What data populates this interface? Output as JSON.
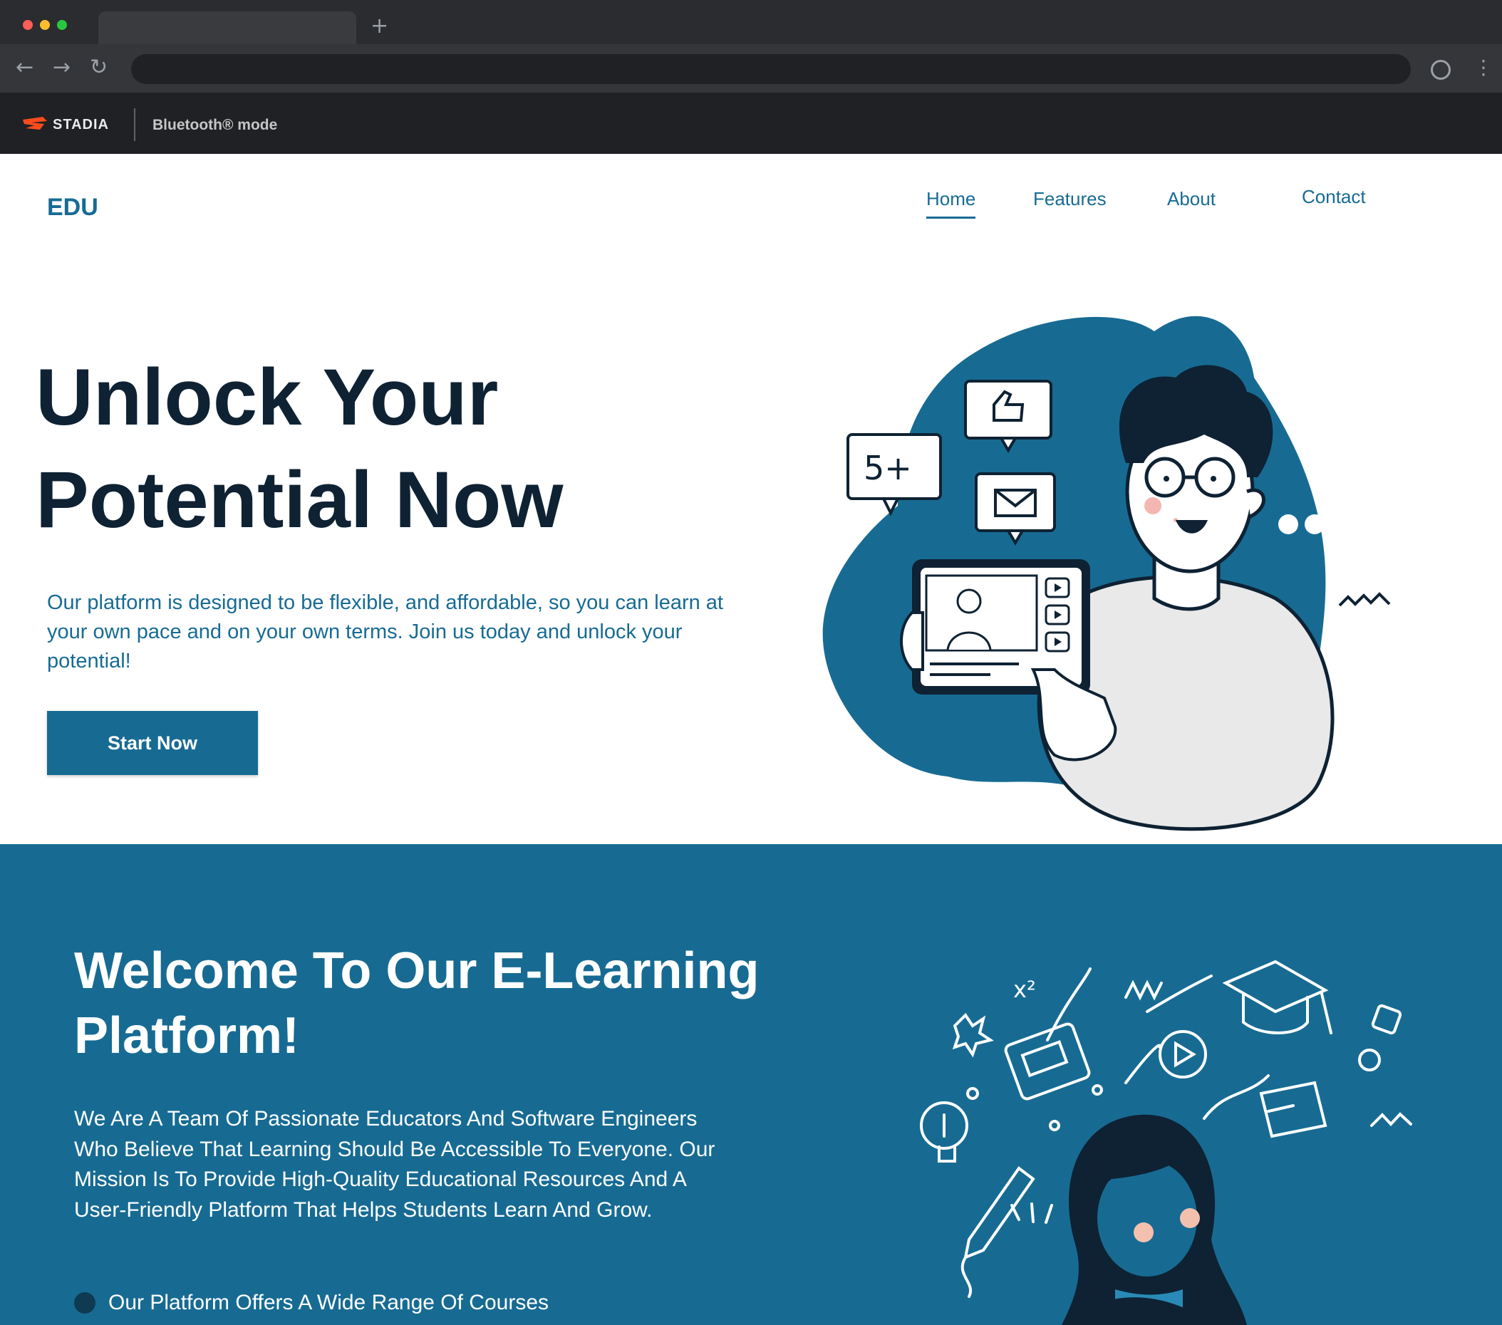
{
  "browser": {
    "new_tab": "+",
    "back": "←",
    "forward": "→",
    "reload": "↻",
    "menu": "⋮",
    "bookmarks": {
      "stadia_label": "STADIA",
      "bluetooth_label": "Bluetooth® mode"
    }
  },
  "header": {
    "brand": "EDU",
    "nav": [
      {
        "label": "Home",
        "active": true
      },
      {
        "label": "Features",
        "active": false
      },
      {
        "label": "About",
        "active": false
      },
      {
        "label": "Contact",
        "active": false
      }
    ]
  },
  "hero": {
    "title": "Unlock Your Potential Now",
    "text": "Our platform is designed to be flexible, and affordable, so you can learn at your own pace and on your own terms. Join us today and unlock your potential!",
    "cta_label": "Start Now",
    "illustration": {
      "badge_text": "5+",
      "icons": [
        "thumbs-up-icon",
        "mail-icon",
        "play-icon"
      ]
    }
  },
  "welcome": {
    "title": "Welcome To Our E-Learning Platform!",
    "text": "We Are A Team Of Passionate Educators And Software Engineers Who Believe That Learning Should Be Accessible To Everyone. Our Mission Is To Provide High-Quality  Educational Resources And A User-Friendly Platform That Helps Students Learn And Grow.",
    "bullets": [
      "Our Platform Offers A Wide Range Of Courses"
    ],
    "illustration": {
      "formula": "x²",
      "icons": [
        "graduation-cap-icon",
        "lightbulb-icon",
        "pencil-icon",
        "folder-icon",
        "calendar-icon",
        "play-icon"
      ]
    }
  },
  "colors": {
    "primary": "#176b93",
    "dark_text": "#0e2233",
    "bullet": "#0e3a52",
    "chrome_bg": "#202124"
  }
}
